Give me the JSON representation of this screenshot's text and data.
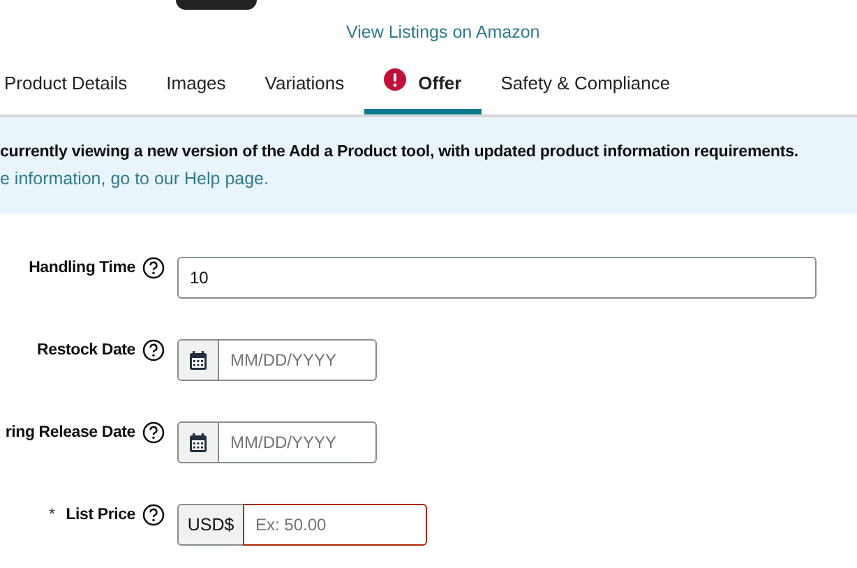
{
  "header": {
    "link": "View Listings on Amazon"
  },
  "tabs": [
    {
      "label": "Product Details",
      "selected": false,
      "error": false
    },
    {
      "label": "Images",
      "selected": false,
      "error": false
    },
    {
      "label": "Variations",
      "selected": false,
      "error": false
    },
    {
      "label": "Offer",
      "selected": true,
      "error": true
    },
    {
      "label": "Safety & Compliance",
      "selected": false,
      "error": false
    }
  ],
  "banner": {
    "message": "currently viewing a new version of the Add a Product tool, with updated product information requirements.",
    "help": "e information, go to our Help page."
  },
  "fields": [
    {
      "kind": "text",
      "label": "Handling Time",
      "value": "10"
    },
    {
      "kind": "date",
      "label": "Restock Date",
      "placeholder": "MM/DD/YYYY"
    },
    {
      "kind": "date",
      "label": "ring Release Date",
      "placeholder": "MM/DD/YYYY"
    },
    {
      "kind": "price",
      "label": "List Price",
      "required_mark": "*",
      "currency": "USD$",
      "placeholder": "Ex: 50.00",
      "invalid": true
    }
  ]
}
